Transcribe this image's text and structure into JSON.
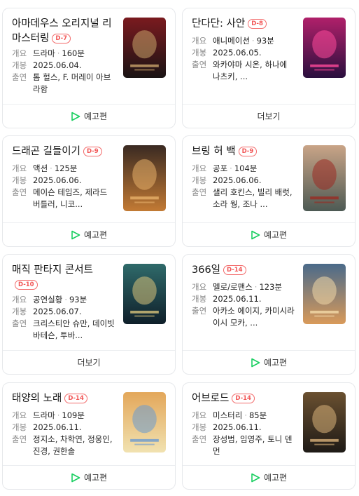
{
  "cards": [
    {
      "title": "아마데우스 오리지널 리마스터링",
      "dday": "D-7",
      "labels": {
        "genre": "개요",
        "release": "개봉",
        "cast": "출연"
      },
      "genre": "드라마",
      "runtime": "160분",
      "release": "2025.06.04.",
      "cast": "톰 헐스, F. 머레이 아브라함",
      "footer": "예고편",
      "poster_colors": [
        "#1a1414",
        "#7a1a1f",
        "#c9a46a"
      ]
    },
    {
      "title": "단다단: 사안",
      "dday": "D-8",
      "labels": {
        "genre": "개요",
        "release": "개봉",
        "cast": "출연"
      },
      "genre": "애니메이션",
      "runtime": "93분",
      "release": "2025.06.05.",
      "cast": "와카야마 시온, 하나에 나츠키, ...",
      "footer": "더보기",
      "poster_colors": [
        "#2a0f3e",
        "#b0206a",
        "#ff4a9a"
      ]
    },
    {
      "title": "드래곤 길들이기",
      "dday": "D-9",
      "labels": {
        "genre": "개요",
        "release": "개봉",
        "cast": "출연"
      },
      "genre": "액션",
      "runtime": "125분",
      "release": "2025.06.06.",
      "cast": "메이슨 테임즈, 제라드 버틀러, 니코...",
      "footer": "예고편",
      "poster_colors": [
        "#c27a34",
        "#3a2a22",
        "#e7b06a"
      ]
    },
    {
      "title": "브링 허 백",
      "dday": "D-9",
      "labels": {
        "genre": "개요",
        "release": "개봉",
        "cast": "출연"
      },
      "genre": "공포",
      "runtime": "104분",
      "release": "2025.06.06.",
      "cast": "샐리 호킨스, 빌리 배럿, 소라 웡, 조나 ...",
      "footer": "예고편",
      "poster_colors": [
        "#4d5a54",
        "#c9a487",
        "#9a2a22"
      ]
    },
    {
      "title": "매직 판타지 콘서트",
      "dday": "D-10",
      "labels": {
        "genre": "개요",
        "release": "개봉",
        "cast": "출연"
      },
      "genre": "공연실황",
      "runtime": "93분",
      "release": "2025.06.07.",
      "cast": "크리스티안 슈만, 데이빗 바테슨, 투바...",
      "footer": "더보기",
      "poster_colors": [
        "#0f1f2a",
        "#2f6a6a",
        "#d8c27a"
      ]
    },
    {
      "title": "366일",
      "dday": "D-14",
      "labels": {
        "genre": "개요",
        "release": "개봉",
        "cast": "출연"
      },
      "genre": "멜로/로맨스",
      "runtime": "123분",
      "release": "2025.06.11.",
      "cast": "아카소 에이지, 카미시라이시 모카, ...",
      "footer": "예고편",
      "poster_colors": [
        "#d99a5a",
        "#4a6a8a",
        "#f3d9a8"
      ]
    },
    {
      "title": "태양의 노래",
      "dday": "D-14",
      "labels": {
        "genre": "개요",
        "release": "개봉",
        "cast": "출연"
      },
      "genre": "드라마",
      "runtime": "109분",
      "release": "2025.06.11.",
      "cast": "정지소, 차학연, 정웅인, 진경, 권한솔",
      "footer": "예고편",
      "poster_colors": [
        "#f1e2b0",
        "#e3a75a",
        "#6a9ad0"
      ]
    },
    {
      "title": "어브로드",
      "dday": "D-14",
      "labels": {
        "genre": "개요",
        "release": "개봉",
        "cast": "출연"
      },
      "genre": "미스터리",
      "runtime": "85분",
      "release": "2025.06.11.",
      "cast": "장성범, 임영주, 토니 덴먼",
      "footer": "예고편",
      "poster_colors": [
        "#1e1a16",
        "#6a5030",
        "#d9b27a"
      ]
    }
  ],
  "colors": {
    "accent_green": "#19ce60",
    "dday_red": "#f25555"
  }
}
